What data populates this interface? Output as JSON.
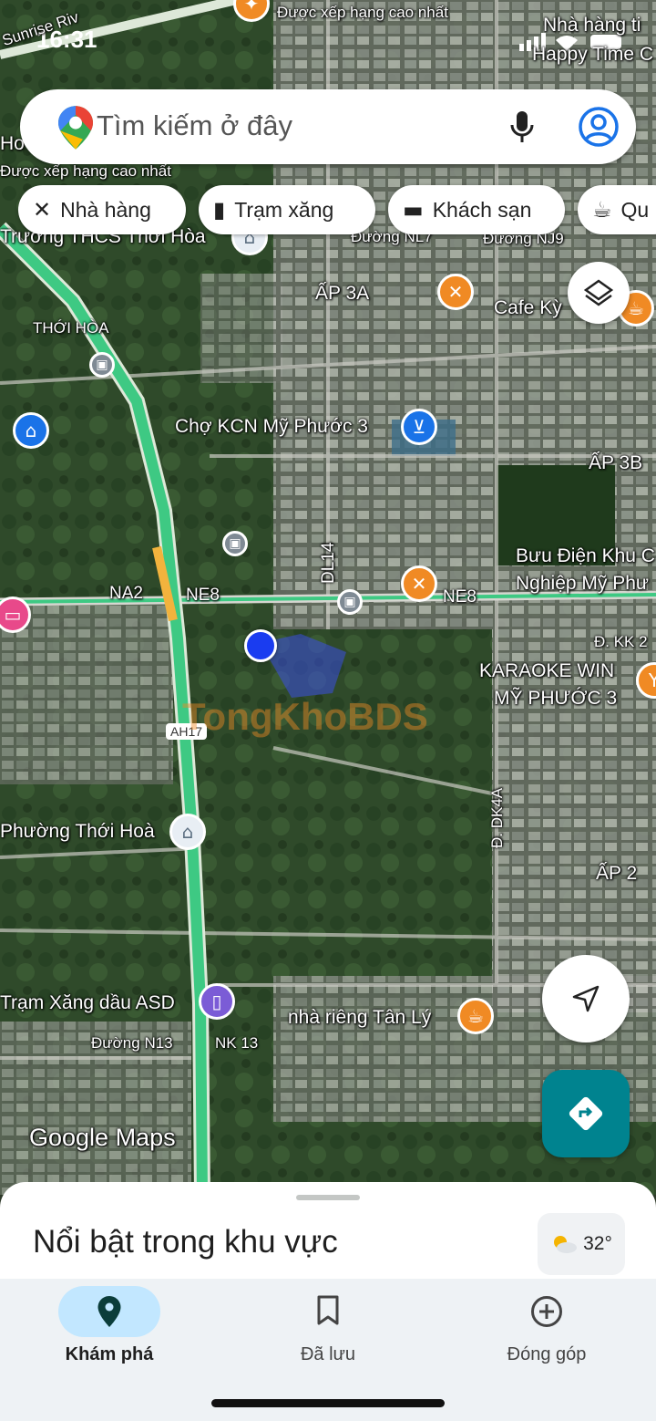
{
  "status_bar": {
    "time": "16:31"
  },
  "search": {
    "placeholder": "Tìm kiếm ở đây"
  },
  "chips": [
    {
      "label": "Nhà hàng",
      "icon": "restaurant-icon"
    },
    {
      "label": "Trạm xăng",
      "icon": "gas-station-icon"
    },
    {
      "label": "Khách sạn",
      "icon": "hotel-icon"
    },
    {
      "label": "Qu",
      "icon": "coffee-icon"
    }
  ],
  "map_labels": {
    "top_rank": "Được xếp hạng cao nhất",
    "top_rank_left": "Được xếp hạng cao nhất",
    "sunrise": "Sunrise Riv",
    "nha_hang": "Nhà hàng ti",
    "happy_time": "Happy Time C",
    "ho": "Ho",
    "truong_thcs": "Trường THCS Thới Hòa",
    "duong_nl7": "Đường NL7",
    "duong_nj9": "Đường NJ9",
    "ap_3a": "ẤP 3A",
    "cafe_ky": "Cafe Kỳ",
    "thoi_hoa": "THỚI HÒA",
    "cho_kcn": "Chợ KCN Mỹ Phước 3",
    "ap_3b": "ẤP 3B",
    "buu_dien_1": "Bưu Điện Khu C",
    "buu_dien_2": "Nghiệp Mỹ Phư",
    "dl14": "DL14",
    "na2": "NA2",
    "ne8_left": "NE8",
    "ne8_right": "NE8",
    "d_kk2": "Đ. KK 2",
    "karaoke_1": "KARAOKE WIN",
    "karaoke_2": "MỸ PHƯỚC 3",
    "ah17": "AH17",
    "d_dk4a": "Đ. DK4A",
    "phuong_thoi_hoa": "Phường Thới Hoà",
    "ap_2": "ẤP 2",
    "tram_xang": "Trạm Xăng dầu ASD",
    "nha_rieng": "nhà riêng Tân Lý",
    "duong_n13": "Đường N13",
    "nk13": "NK 13",
    "google_maps": "Google Maps",
    "watermark": "TongKhoBDS"
  },
  "sheet": {
    "title": "Nổi bật trong khu vực",
    "weather": "32°"
  },
  "nav": [
    {
      "label": "Khám phá",
      "icon": "explore-pin-icon",
      "active": true
    },
    {
      "label": "Đã lưu",
      "icon": "bookmark-icon",
      "active": false
    },
    {
      "label": "Đóng góp",
      "icon": "add-circle-icon",
      "active": false
    }
  ],
  "colors": {
    "accent": "#1a73e8",
    "nav_active_bg": "#c2e7ff",
    "directions_fab": "#00838f",
    "highway": "#3ec983"
  }
}
